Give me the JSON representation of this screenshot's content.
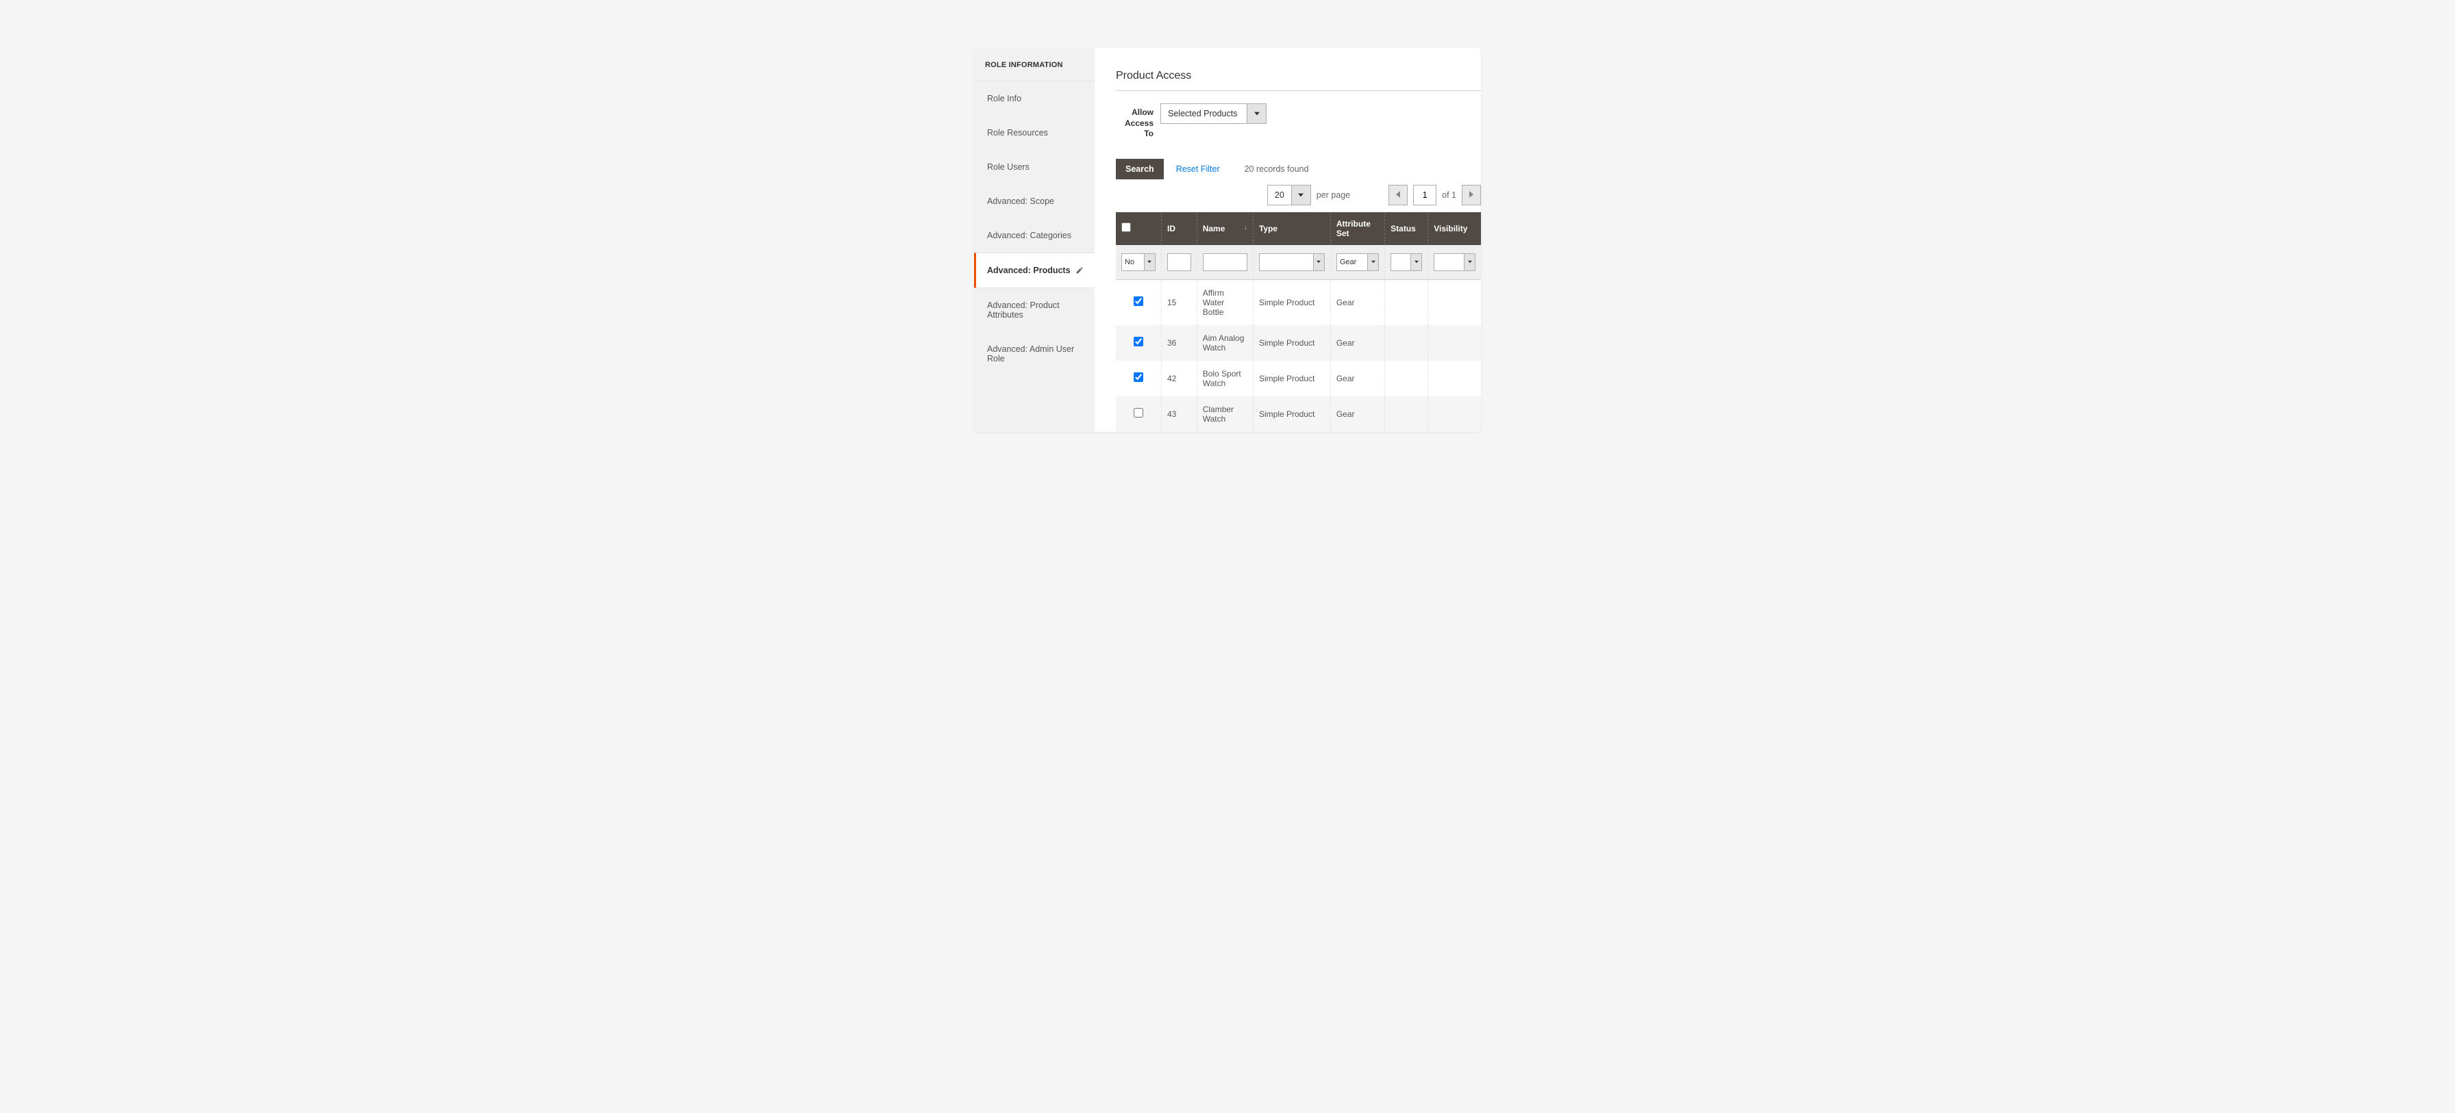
{
  "sidebar": {
    "header": "ROLE INFORMATION",
    "items": [
      {
        "label": "Role Info"
      },
      {
        "label": "Role Resources"
      },
      {
        "label": "Role Users"
      },
      {
        "label": "Advanced: Scope"
      },
      {
        "label": "Advanced: Categories"
      },
      {
        "label": "Advanced: Products"
      },
      {
        "label": "Advanced: Product Attributes"
      },
      {
        "label": "Advanced: Admin User Role"
      }
    ]
  },
  "section_title": "Product Access",
  "form": {
    "access_label": "Allow Access To",
    "access_value": "Selected Products"
  },
  "toolbar": {
    "search": "Search",
    "reset": "Reset Filter",
    "records": "20 records found"
  },
  "pager": {
    "per_page_value": "20",
    "per_page_label": "per page",
    "page": "1",
    "of_label": "of 1"
  },
  "columns": {
    "id": "ID",
    "name": "Name",
    "type": "Type",
    "attr": "Attribute Set",
    "status": "Status",
    "vis": "Visibility"
  },
  "filters": {
    "check": "No",
    "attr": "Gear"
  },
  "rows": [
    {
      "checked": true,
      "id": "15",
      "name": "Affirm Water Bottle",
      "type": "Simple Product",
      "attr": "Gear"
    },
    {
      "checked": true,
      "id": "36",
      "name": "Aim Analog Watch",
      "type": "Simple Product",
      "attr": "Gear"
    },
    {
      "checked": true,
      "id": "42",
      "name": "Bolo Sport Watch",
      "type": "Simple Product",
      "attr": "Gear"
    },
    {
      "checked": false,
      "id": "43",
      "name": "Clamber Watch",
      "type": "Simple Product",
      "attr": "Gear"
    }
  ]
}
